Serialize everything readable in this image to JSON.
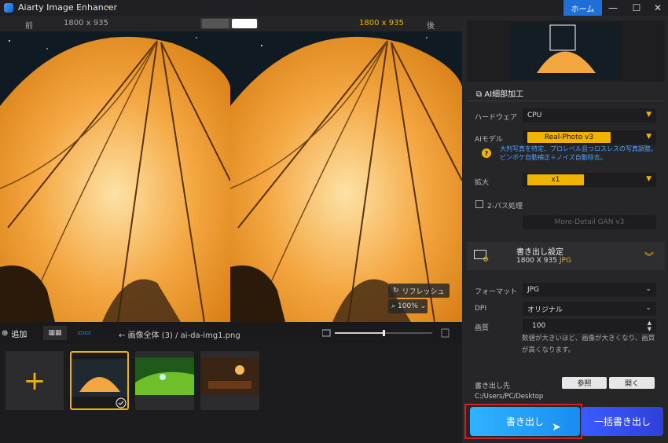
{
  "app": {
    "title": "Aiarty Image Enhancer",
    "home_label": "ホーム"
  },
  "compare": {
    "before_label": "前",
    "before_size": "1800 x 935",
    "after_size": "1800 x 935",
    "after_label": "後"
  },
  "overlay": {
    "refresh_label": "リフレッシュ",
    "zoom_value": "100%"
  },
  "bottombar": {
    "add_label": "追加",
    "breadcrumb_all": "画像全体 (3)",
    "breadcrumb_sep": "/",
    "breadcrumb_file": "ai-da-img1.png"
  },
  "ai_panel": {
    "title": "AI細部加工",
    "hardware_label": "ハードウェア",
    "hardware_value": "CPU",
    "model_label": "AIモデル",
    "model_value": "Real-Photo  v3",
    "model_desc": "大判写真を特定、プロレベル且つロスレスの写真調整。ピンボケ自動補正＋ノイズ自動除去。",
    "scale_label": "拡大",
    "scale_value": "x1",
    "twopass_label": "2-パス処理",
    "twopass_model": "More-Detail GAN  v3"
  },
  "export": {
    "title": "書き出し設定",
    "size": "1800 X 935",
    "format_badge": "JPG",
    "format_label": "フォーマット",
    "format_value": "JPG",
    "dpi_label": "DPI",
    "dpi_value": "オリジナル",
    "quality_label": "画質",
    "quality_value": "100",
    "quality_desc": "数値が大きいほど、画像が大きくなり、画質が高くなります。",
    "dest_label": "書き出し先",
    "dest_path": "C:/Users/PC/Desktop",
    "browse_label": "参照",
    "open_label": "開く",
    "export_button": "書き出し",
    "batch_button": "一括書き出し"
  },
  "colors": {
    "accent": "#f0b400",
    "blue": "#1f6fd9",
    "highlight": "#d0202a"
  }
}
